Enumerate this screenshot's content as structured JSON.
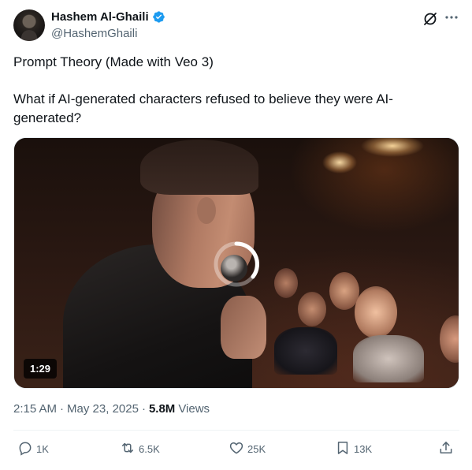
{
  "author": {
    "display_name": "Hashem Al-Ghaili",
    "handle": "@HashemGhaili",
    "verified_color": "#1d9bf0"
  },
  "tweet": {
    "line1": "Prompt Theory (Made with Veo 3)",
    "line2": "What if AI-generated characters refused to believe they were AI-generated?"
  },
  "media": {
    "type": "video",
    "duration": "1:29",
    "loading_icon": "spinner-icon"
  },
  "meta": {
    "time": "2:15 AM",
    "separator": "·",
    "date": "May 23, 2025",
    "separator2": "·",
    "views_count": "5.8M",
    "views_label": "Views"
  },
  "actions": {
    "reply": {
      "icon": "reply-icon",
      "count": "1K"
    },
    "retweet": {
      "icon": "retweet-icon",
      "count": "6.5K"
    },
    "like": {
      "icon": "heart-icon",
      "count": "25K"
    },
    "bookmark": {
      "icon": "bookmark-icon",
      "count": "13K"
    },
    "share": {
      "icon": "share-icon"
    }
  },
  "colors": {
    "text_primary": "#0f1419",
    "text_secondary": "#536471",
    "accent": "#1d9bf0"
  }
}
